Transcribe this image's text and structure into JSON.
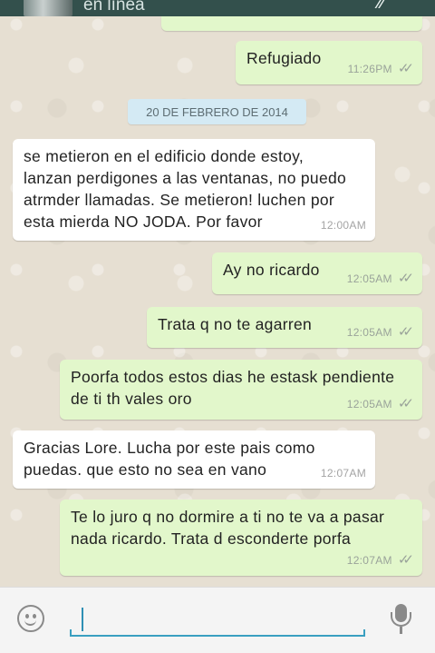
{
  "header": {
    "status": "en línea"
  },
  "date_chip": "20 DE FEBRERO DE 2014",
  "messages": [
    {
      "dir": "out",
      "text": "Refugiado",
      "time": "11:26PM",
      "ticks": "✓✓"
    },
    {
      "dir": "in",
      "text": "se metieron en el edificio donde estoy,\nlanzan perdigones a las ventanas, no puedo\natrmder llamadas. Se metieron! luchen por\nesta mierda NO JODA. Por favor",
      "time": "12:00AM"
    },
    {
      "dir": "out",
      "text": "Ay no ricardo",
      "time": "12:05AM",
      "ticks": "✓✓"
    },
    {
      "dir": "out",
      "text": "Trata q no te agarren",
      "time": "12:05AM",
      "ticks": "✓✓"
    },
    {
      "dir": "out",
      "text": "Poorfa todos estos dias he estask pendiente\nde ti th vales oro",
      "time": "12:05AM",
      "ticks": "✓✓"
    },
    {
      "dir": "in",
      "text": "Gracias Lore. Lucha por este pais como\npuedas. que esto no sea en vano",
      "time": "12:07AM"
    },
    {
      "dir": "out",
      "text": "Te lo juro q no dormire a ti no te va a pasar\nnada ricardo. Trata d esconderte porfa",
      "time": "12:07AM",
      "ticks": "✓✓"
    }
  ],
  "input": {
    "value": "",
    "placeholder": ""
  },
  "icons": {
    "emoji": "emoji-icon",
    "mic": "microphone-icon",
    "attach": "paperclip-icon"
  },
  "colors": {
    "outgoing_bubble": "#e2f7cb",
    "incoming_bubble": "#ffffff",
    "header": "#33504c",
    "accent": "#3a9fc0"
  }
}
